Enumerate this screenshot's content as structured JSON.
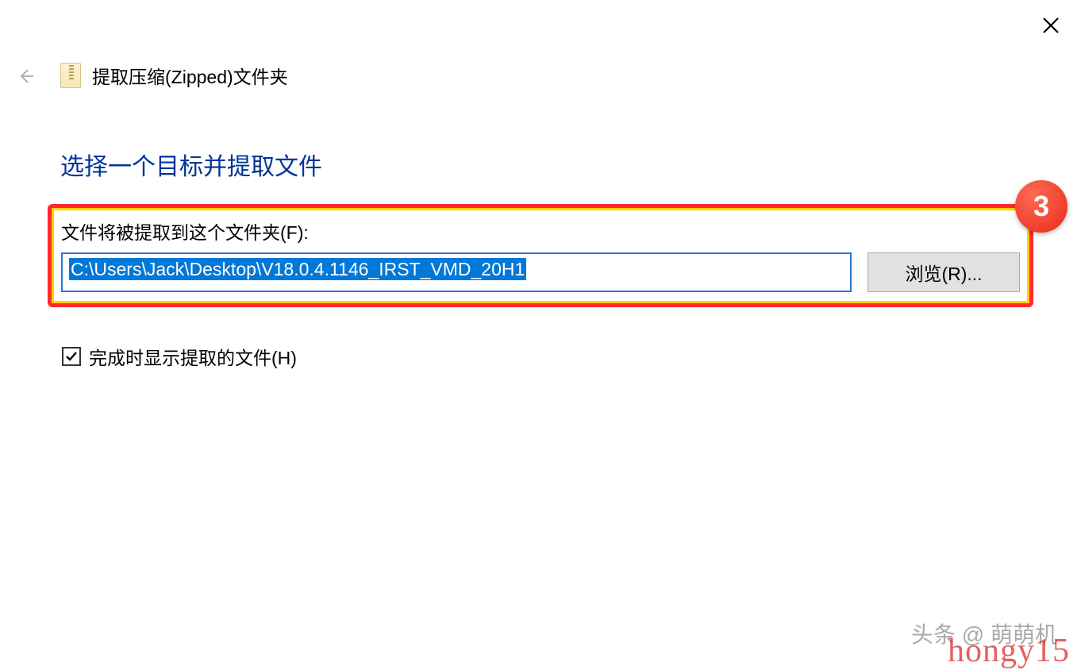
{
  "window": {
    "title": "提取压缩(Zipped)文件夹"
  },
  "heading": "选择一个目标并提取文件",
  "extract": {
    "label": "文件将被提取到这个文件夹(F):",
    "path": "C:\\Users\\Jack\\Desktop\\V18.0.4.1146_IRST_VMD_20H1",
    "browse_label": "浏览(R)..."
  },
  "checkbox": {
    "label": "完成时显示提取的文件(H)",
    "checked": true
  },
  "annotation": {
    "badge": "3"
  },
  "watermarks": {
    "top": "头条 @ 萌萌机",
    "bottom": "hongy15"
  }
}
